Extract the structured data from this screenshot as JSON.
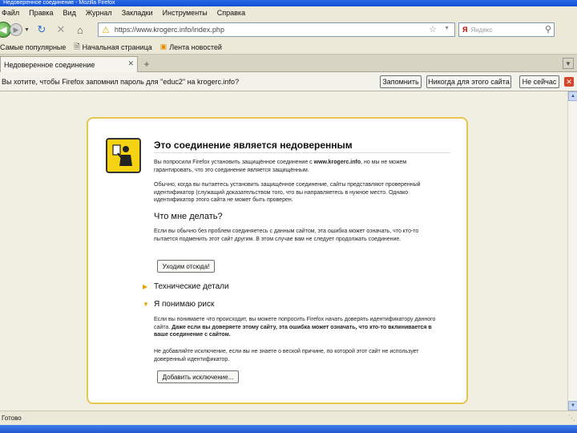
{
  "window": {
    "title": "Недоверенное соединение - Mozilla Firefox"
  },
  "menu": [
    "Файл",
    "Правка",
    "Вид",
    "Журнал",
    "Закладки",
    "Инструменты",
    "Справка"
  ],
  "nav": {
    "url": "https://www.krogerc.info/index.php",
    "search_engine": "Я",
    "search_placeholder": "Яндекс"
  },
  "bookmarks": [
    {
      "label": "Самые популярные"
    },
    {
      "label": "Начальная страница"
    },
    {
      "label": "Лента новостей"
    }
  ],
  "tabs": [
    {
      "label": "Недоверенное соединение"
    }
  ],
  "notification": {
    "text": "Вы хотите, чтобы Firefox запомнил пароль для \"educ2\" на krogerc.info?",
    "remember": "Запомнить",
    "never": "Никогда для этого сайта",
    "not_now": "Не сейчас"
  },
  "error_page": {
    "title": "Это соединение является недоверенным",
    "intro_pre": "Вы попросили Firefox установить защищённое соединение с ",
    "intro_host": "www.krogerc.info",
    "intro_post": ", но мы не можем гарантировать, что это соединение является защищённым.",
    "para2": "Обычно, когда вы пытаетесь установить защищённое соединение, сайты представляют проверенный идентификатор (служащий доказательством того, что вы направляетесь в нужное место. Однако идентификатор этого сайта не может быть проверен.",
    "what_to_do": "Что мне делать?",
    "para3": "Если вы обычно без проблем соединяетесь с данным сайтом, эта ошибка может означать, что кто-то пытается подменить этот сайт другим. В этом случае вам не следует продолжать соединение.",
    "leave_button": "Уходим отсюда!",
    "tech_details": "Технические детали",
    "understand_risks": "Я понимаю риск",
    "para4_pre": "Если вы понимаете что происходит, вы можете попросить Firefox начать доверять идентификатору данного сайта. ",
    "para4_bold": "Даже если вы доверяете этому сайту, эта ошибка может означать, что кто-то вклинивается в ваше соединение с сайтом.",
    "para5": "Не добавляйте исключение, если вы не знаете о веской причине, по которой этот сайт не использует доверенный идентификатор.",
    "add_exception_button": "Добавить исключение..."
  },
  "status": {
    "text": "Готово"
  }
}
